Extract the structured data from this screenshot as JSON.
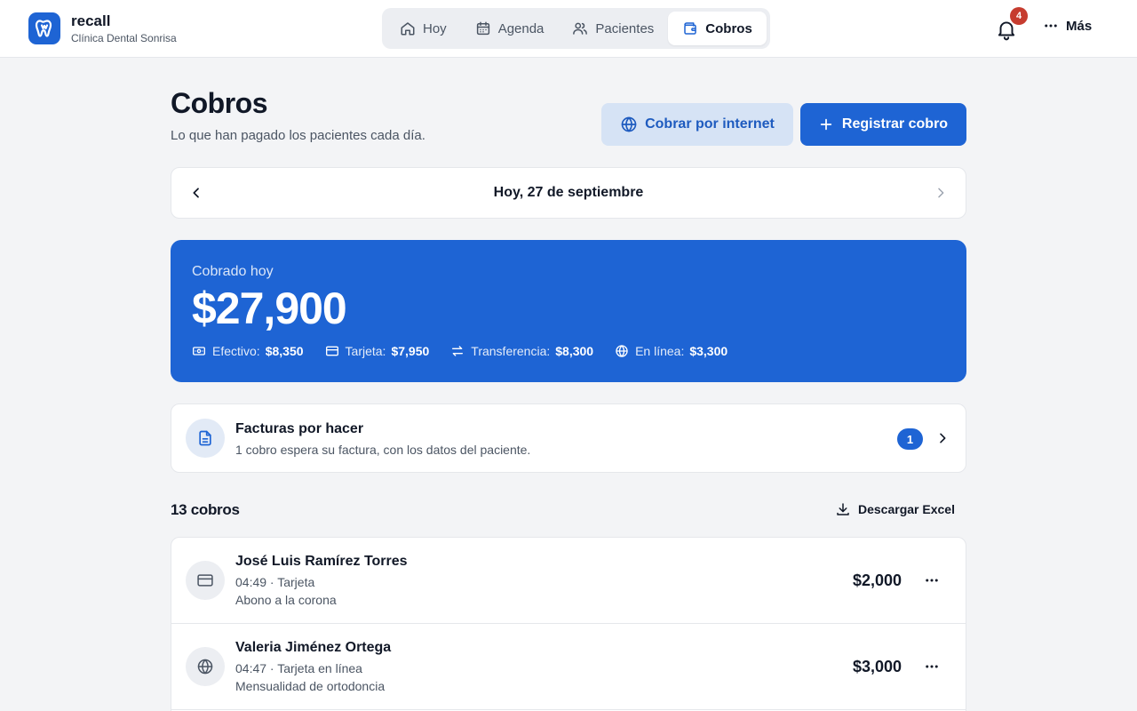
{
  "brand": {
    "name": "recall",
    "clinic": "Clínica Dental Sonrisa"
  },
  "nav": [
    {
      "label": "Hoy",
      "icon": "home-icon",
      "active": false
    },
    {
      "label": "Agenda",
      "icon": "calendar-icon",
      "active": false
    },
    {
      "label": "Pacientes",
      "icon": "users-icon",
      "active": false
    },
    {
      "label": "Cobros",
      "icon": "wallet-icon",
      "active": true
    }
  ],
  "header": {
    "notifications_count": "4",
    "more_label": "Más"
  },
  "page": {
    "title": "Cobros",
    "subtitle": "Lo que han pagado los pacientes cada día.",
    "online_button": "Cobrar por internet",
    "register_button": "Registrar cobro"
  },
  "date_nav": {
    "label": "Hoy, 27 de septiembre"
  },
  "summary": {
    "label": "Cobrado hoy",
    "amount": "$27,900",
    "breakdown": [
      {
        "label": "Efectivo:",
        "value": "$8,350",
        "icon": "cash-icon"
      },
      {
        "label": "Tarjeta:",
        "value": "$7,950",
        "icon": "card-icon"
      },
      {
        "label": "Transferencia:",
        "value": "$8,300",
        "icon": "transfer-icon"
      },
      {
        "label": "En línea:",
        "value": "$3,300",
        "icon": "globe-icon"
      }
    ]
  },
  "invoices": {
    "title": "Facturas por hacer",
    "subtitle": "1 cobro espera su factura, con los datos del paciente.",
    "count": "1"
  },
  "list": {
    "count_label": "13 cobros",
    "download_label": "Descargar Excel",
    "items": [
      {
        "name": "José Luis Ramírez Torres",
        "meta": "04:49 · Tarjeta",
        "note": "Abono a la corona",
        "amount": "$2,000",
        "icon": "card-icon"
      },
      {
        "name": "Valeria Jiménez Ortega",
        "meta": "04:47 · Tarjeta en línea",
        "note": "Mensualidad de ortodoncia",
        "amount": "$3,000",
        "icon": "globe-icon"
      }
    ]
  },
  "colors": {
    "primary": "#1e64d4",
    "badge_red": "#c63c2f",
    "background": "#f3f4f6"
  }
}
